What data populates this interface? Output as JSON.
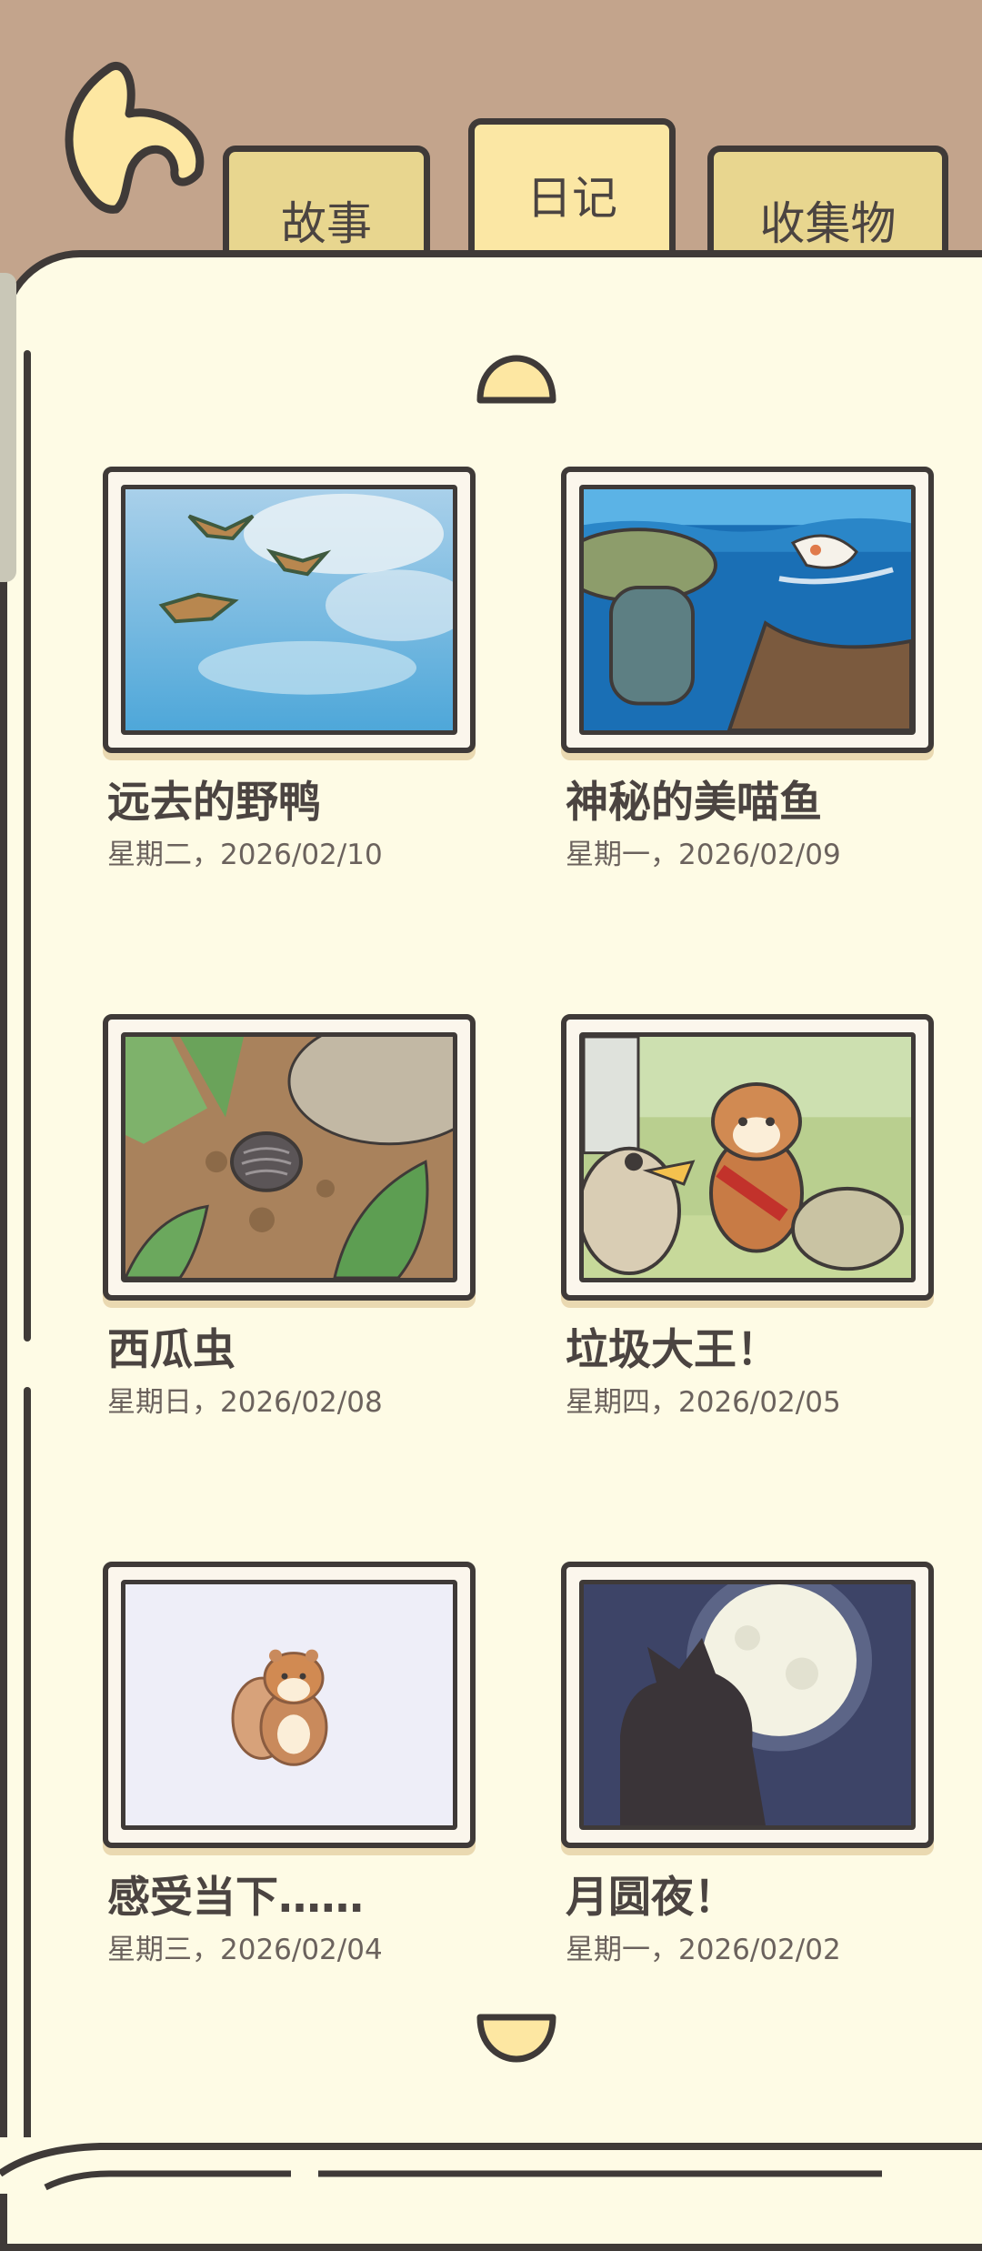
{
  "tabs": [
    {
      "label": "故事"
    },
    {
      "label": "日记",
      "active": true
    },
    {
      "label": "收集物"
    }
  ],
  "entries": [
    {
      "title": "远去的野鸭",
      "date": "星期二，2026/02/10",
      "scene": "wild-ducks-flying"
    },
    {
      "title": "神秘的美喵鱼",
      "date": "星期一，2026/02/09",
      "scene": "fisherman-and-koi"
    },
    {
      "title": "西瓜虫",
      "date": "星期日，2026/02/08",
      "scene": "pill-bug-in-grass"
    },
    {
      "title": "垃圾大王！",
      "date": "星期四，2026/02/05",
      "scene": "squirrel-and-duck"
    },
    {
      "title": "感受当下……",
      "date": "星期三，2026/02/04",
      "scene": "squirrel-sitting"
    },
    {
      "title": "月圆夜！",
      "date": "星期一，2026/02/02",
      "scene": "cat-under-full-moon"
    }
  ],
  "colors": {
    "page": "#fefbe5",
    "frame_bg": "#c3a48c",
    "tab": "#e8d68f",
    "tab_active": "#fbe7a4",
    "outline": "#3f3a38"
  }
}
